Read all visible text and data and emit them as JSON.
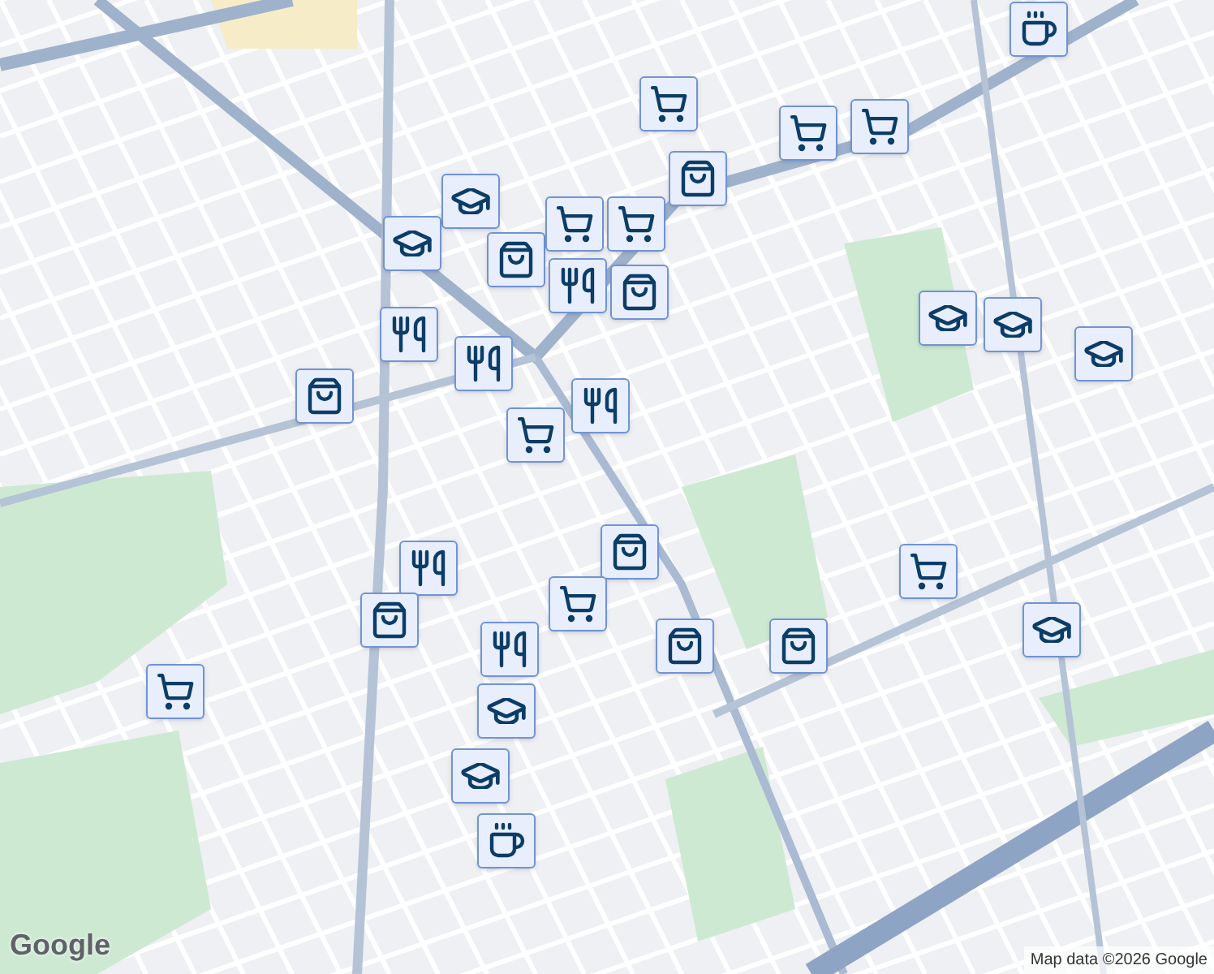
{
  "markers": [
    {
      "kind": "cup"
    },
    {
      "kind": "cart"
    },
    {
      "kind": "cart"
    },
    {
      "kind": "cart"
    },
    {
      "kind": "bag"
    },
    {
      "kind": "school"
    },
    {
      "kind": "school"
    },
    {
      "kind": "bag"
    },
    {
      "kind": "cart"
    },
    {
      "kind": "cart"
    },
    {
      "kind": "bag"
    },
    {
      "kind": "food"
    },
    {
      "kind": "food"
    },
    {
      "kind": "food"
    },
    {
      "kind": "bag"
    },
    {
      "kind": "food"
    },
    {
      "kind": "cart"
    },
    {
      "kind": "bag"
    },
    {
      "kind": "food"
    },
    {
      "kind": "bag"
    },
    {
      "kind": "cart"
    },
    {
      "kind": "food"
    },
    {
      "kind": "school"
    },
    {
      "kind": "bag"
    },
    {
      "kind": "bag"
    },
    {
      "kind": "cart"
    },
    {
      "kind": "school"
    },
    {
      "kind": "school"
    },
    {
      "kind": "school"
    },
    {
      "kind": "school"
    },
    {
      "kind": "cart"
    },
    {
      "kind": "school"
    },
    {
      "kind": "cup"
    }
  ],
  "logo": "Google",
  "attribution": "Map data ©2026 Google"
}
